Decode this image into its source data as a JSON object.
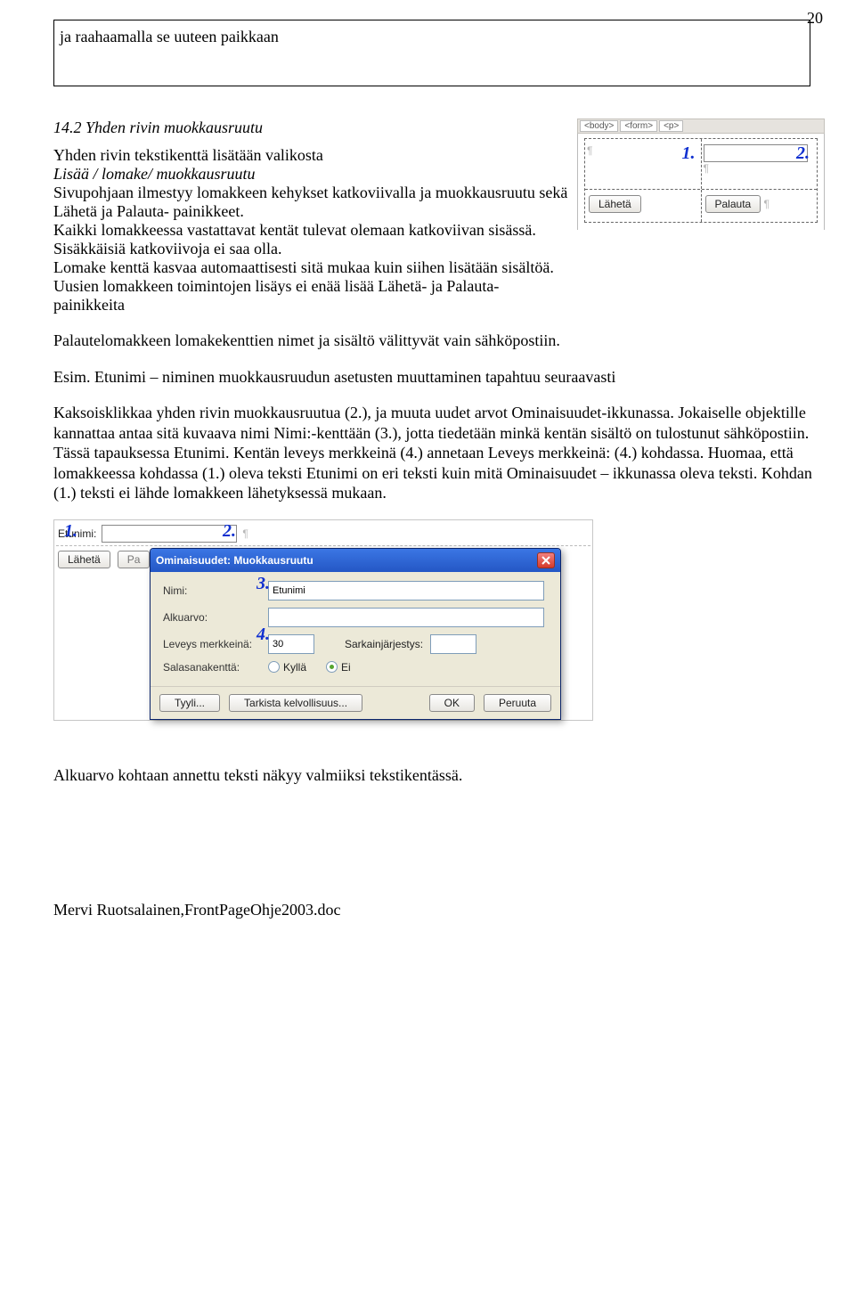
{
  "page_number": "20",
  "box_text": "ja raahaamalla se uuteen paikkaan",
  "section": {
    "heading": "14.2 Yhden rivin muokkausruutu",
    "intro1": "Yhden rivin tekstikenttä lisätään valikosta",
    "menu_path": " Lisää / lomake/ muokkausruutu",
    "para1": "Sivupohjaan ilmestyy lomakkeen kehykset katkoviivalla ja muokkausruutu sekä Lähetä ja Palauta- painikkeet.",
    "para2": "Kaikki lomakkeessa vastattavat kentät tulevat olemaan katkoviivan sisässä. Sisäkkäisiä katkoviivoja ei saa olla.",
    "para3": "Lomake kenttä kasvaa automaattisesti sitä mukaa kuin siihen lisätään sisältöä.",
    "para4": "Uusien lomakkeen toimintojen lisäys ei enää lisää Lähetä- ja Palauta-painikkeita"
  },
  "body_para1": "Palautelomakkeen lomakekenttien nimet ja sisältö välittyvät vain sähköpostiin.",
  "body_para2": "Esim. Etunimi – niminen muokkausruudun asetusten muuttaminen tapahtuu seuraavasti",
  "body_para3": "Kaksoisklikkaa yhden rivin muokkausruutua (2.), ja muuta uudet arvot Ominaisuudet-ikkunassa. Jokaiselle objektille kannattaa antaa sitä kuvaava nimi Nimi:-kenttään (3.), jotta tiedetään minkä kentän sisältö on tulostunut sähköpostiin. Tässä tapauksessa Etunimi. Kentän leveys merkkeinä (4.) annetaan Leveys merkkeinä: (4.) kohdassa. Huomaa, että lomakkeessa kohdassa (1.) oleva teksti Etunimi on eri teksti kuin mitä Ominaisuudet – ikkunassa oleva teksti. Kohdan (1.) teksti ei lähde lomakkeen lähetyksessä mukaan.",
  "after_shot2": "Alkuarvo kohtaan annettu teksti näkyy valmiiksi tekstikentässä.",
  "footer": "Mervi Ruotsalainen,FrontPageOhje2003.doc",
  "shot1": {
    "bc1": "<body>",
    "bc2": "<form>",
    "bc3": "<p>",
    "callout1": "1.",
    "callout2": "2.",
    "btn_send": "Lähetä",
    "btn_reset": "Palauta",
    "pil": "¶"
  },
  "shot2": {
    "field_label": "Etunimi:",
    "btn_send": "Lähetä",
    "btn_pa": "Pa",
    "callout1": "1.",
    "callout2": "2.",
    "callout3": "3.",
    "callout4": "4.",
    "dialog_title": "Ominaisuudet: Muokkausruutu",
    "lbl_nimi": "Nimi:",
    "val_nimi": "Etunimi",
    "lbl_alkuarvo": "Alkuarvo:",
    "val_alkuarvo": "",
    "lbl_leveys": "Leveys merkkeinä:",
    "val_leveys": "30",
    "lbl_sarkain": "Sarkainjärjestys:",
    "val_sarkain": "",
    "lbl_salasana": "Salasanakenttä:",
    "radio_yes": "Kyllä",
    "radio_no": "Ei",
    "btn_tyyli": "Tyyli...",
    "btn_tarkista": "Tarkista kelvollisuus...",
    "btn_ok": "OK",
    "btn_peruuta": "Peruuta"
  }
}
